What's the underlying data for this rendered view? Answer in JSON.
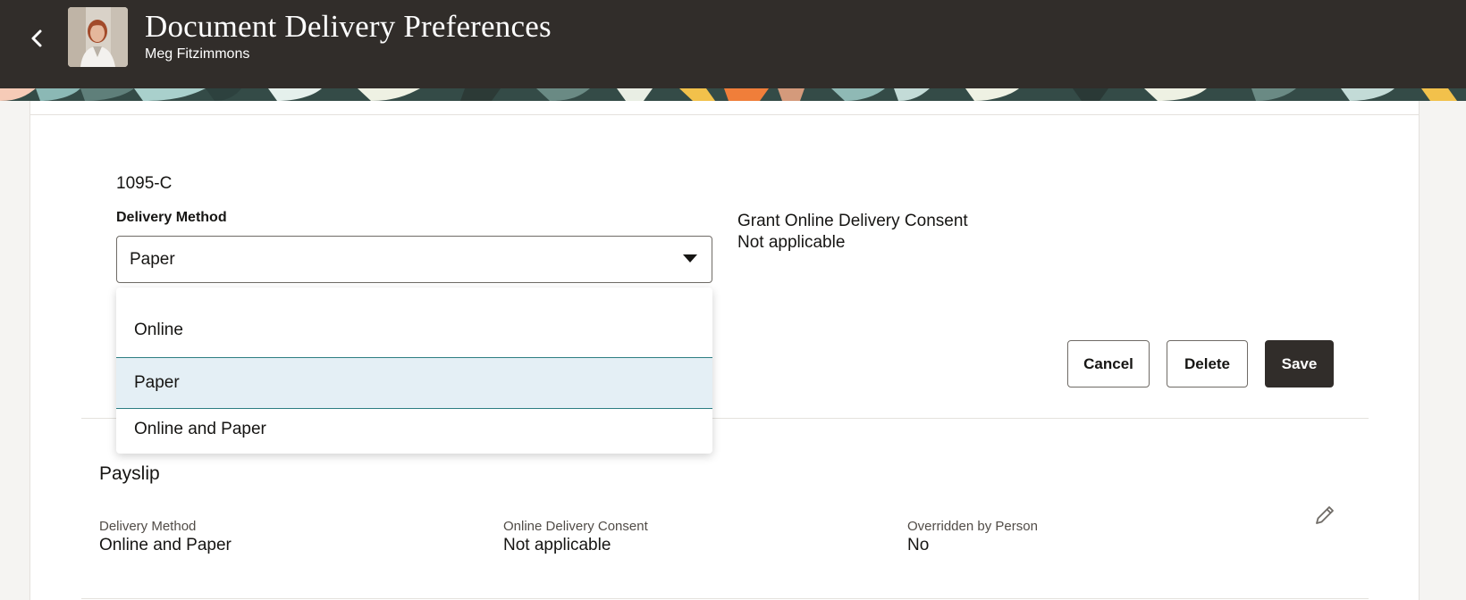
{
  "header": {
    "title": "Document Delivery Preferences",
    "subtitle": "Meg Fitzimmons",
    "back_icon": "chevron-left-icon"
  },
  "form": {
    "document_name": "1095-C",
    "delivery_method_label": "Delivery Method",
    "delivery_method_value": "Paper",
    "dropdown_options": [
      "Online",
      "Paper",
      "Online and Paper"
    ],
    "selected_option": "Paper",
    "consent_label": "Grant Online Delivery Consent",
    "consent_value": "Not applicable",
    "buttons": {
      "cancel": "Cancel",
      "delete": "Delete",
      "save": "Save"
    }
  },
  "payslip": {
    "title": "Payslip",
    "fields": [
      {
        "label": "Delivery Method",
        "value": "Online and Paper"
      },
      {
        "label": "Online Delivery Consent",
        "value": "Not applicable"
      },
      {
        "label": "Overridden by Person",
        "value": "No"
      }
    ],
    "edit_icon": "pencil-icon"
  },
  "colors": {
    "header_bg": "#312d2a",
    "selected_option_bg": "#e4eff5",
    "selected_option_border": "#2d7d82",
    "primary_button": "#312d2a"
  }
}
